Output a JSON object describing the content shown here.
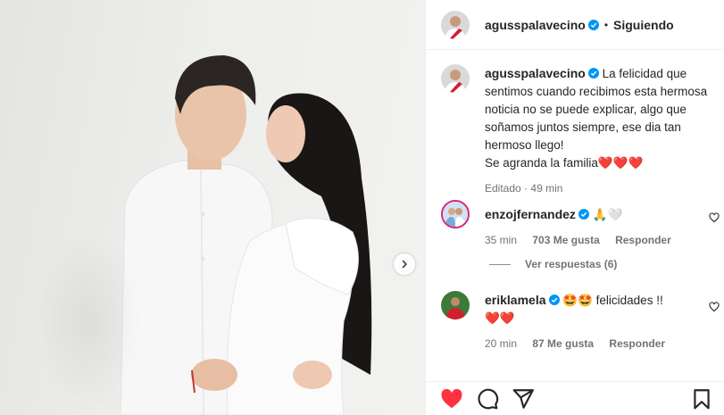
{
  "post": {
    "username": "aguss­palavecino",
    "follow_status": "Siguiendo",
    "separator": "•"
  },
  "caption": {
    "username": "agusspalavecino",
    "text": "La felicidad que sentimos cuando recibimos esta hermosa noticia no se puede explicar, algo que soñamos juntos siempre, ese dia tan hermoso llego!\nSe agranda la familia",
    "hearts": "❤️❤️❤️",
    "edited": "Editado",
    "time": "49 min"
  },
  "comments": [
    {
      "username": "enzojfernandez",
      "text": "🙏🤍",
      "time": "35 min",
      "likes": "703 Me gusta",
      "reply_label": "Responder",
      "view_replies": "Ver respuestas (6)"
    },
    {
      "username": "eriklamela",
      "text_emoji": "🤩🤩",
      "text": "felicidades !!",
      "line2": "❤️❤️",
      "time": "20 min",
      "likes": "87 Me gusta",
      "reply_label": "Responder"
    }
  ],
  "icons": [
    "next-arrow-icon",
    "verified-icon",
    "heart-icon",
    "comment-icon",
    "share-icon",
    "save-icon"
  ],
  "colors": {
    "accent_red": "#ff3040",
    "verified_blue": "#0095f6",
    "meta_gray": "#737373"
  }
}
